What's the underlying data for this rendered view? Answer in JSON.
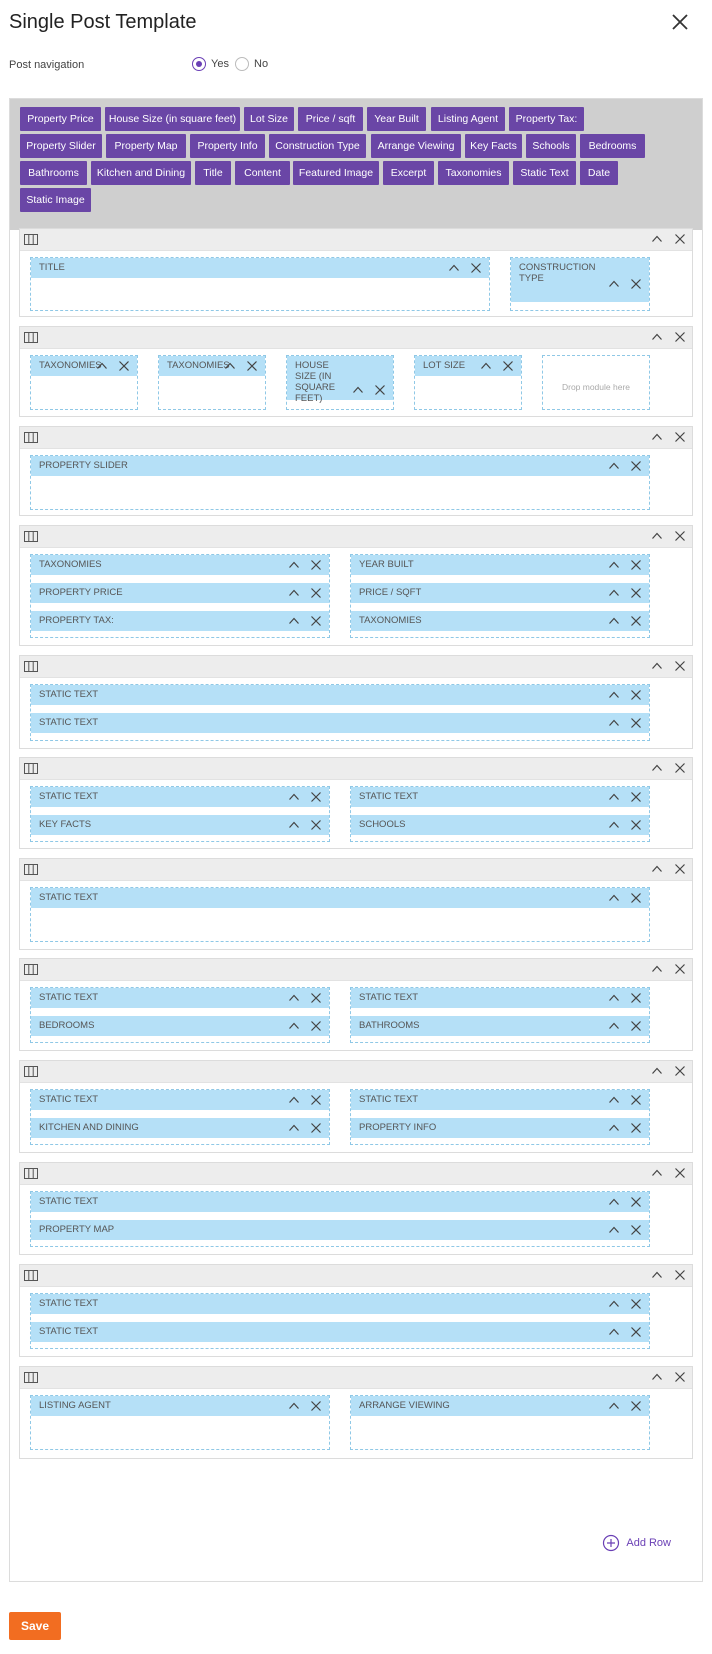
{
  "header": {
    "title": "Single Post Template"
  },
  "post_navigation": {
    "label": "Post navigation",
    "yes": "Yes",
    "no": "No",
    "selected": "Yes"
  },
  "palette": {
    "modules": [
      "Property Price",
      "House Size (in square feet)",
      "Lot Size",
      "Price / sqft",
      "Year Built",
      "Listing Agent",
      "Property Tax:",
      "Property Slider",
      "Property Map",
      "Property Info",
      "Construction Type",
      "Arrange Viewing",
      "Key Facts",
      "Schools",
      "Bedrooms",
      "Bathrooms",
      "Kitchen and Dining",
      "Title",
      "Content",
      "Featured Image",
      "Excerpt",
      "Taxonomies",
      "Static Text",
      "Date",
      "Static Image"
    ]
  },
  "rows": [
    {
      "columns": [
        {
          "modules": [
            "Title"
          ]
        },
        {
          "modules": [
            "Construction Type"
          ]
        }
      ]
    },
    {
      "columns": [
        {
          "modules": [
            "Taxonomies"
          ]
        },
        {
          "modules": [
            "Taxonomies"
          ]
        },
        {
          "modules": [
            "House Size (in square feet)"
          ]
        },
        {
          "modules": [
            "Lot Size"
          ]
        },
        {
          "modules": [],
          "drop_text": "Drop module here"
        }
      ]
    },
    {
      "columns": [
        {
          "modules": [
            "Property Slider"
          ]
        }
      ]
    },
    {
      "columns": [
        {
          "modules": [
            "Taxonomies",
            "Property Price",
            "Property Tax:"
          ]
        },
        {
          "modules": [
            "Year Built",
            "Price / sqft",
            "Taxonomies"
          ]
        }
      ]
    },
    {
      "columns": [
        {
          "modules": [
            "Static Text",
            "Static Text"
          ]
        }
      ]
    },
    {
      "columns": [
        {
          "modules": [
            "Static Text",
            "Key Facts"
          ]
        },
        {
          "modules": [
            "Static Text",
            "Schools"
          ]
        }
      ]
    },
    {
      "columns": [
        {
          "modules": [
            "Static Text"
          ]
        }
      ]
    },
    {
      "columns": [
        {
          "modules": [
            "Static Text",
            "Bedrooms"
          ]
        },
        {
          "modules": [
            "Static Text",
            "Bathrooms"
          ]
        }
      ]
    },
    {
      "columns": [
        {
          "modules": [
            "Static Text",
            "Kitchen and Dining"
          ]
        },
        {
          "modules": [
            "Static Text",
            "Property Info"
          ]
        }
      ]
    },
    {
      "columns": [
        {
          "modules": [
            "Static Text",
            "Property Map"
          ]
        }
      ]
    },
    {
      "columns": [
        {
          "modules": [
            "Static Text",
            "Static Text"
          ]
        }
      ]
    },
    {
      "columns": [
        {
          "modules": [
            "Listing Agent"
          ]
        },
        {
          "modules": [
            "Arrange Viewing"
          ]
        }
      ]
    }
  ],
  "footer": {
    "add_row_label": "Add Row",
    "save_label": "Save"
  },
  "colors": {
    "accent": "#6a46a6",
    "module_bg": "#b5e0f7",
    "save_bg": "#f26d21",
    "palette_bg": "#cfcfcf"
  },
  "icons": {
    "close": "close-icon",
    "columns": "columns-icon",
    "collapse": "chevron-up-icon",
    "remove": "close-icon",
    "add_row": "plus-circle-icon"
  }
}
